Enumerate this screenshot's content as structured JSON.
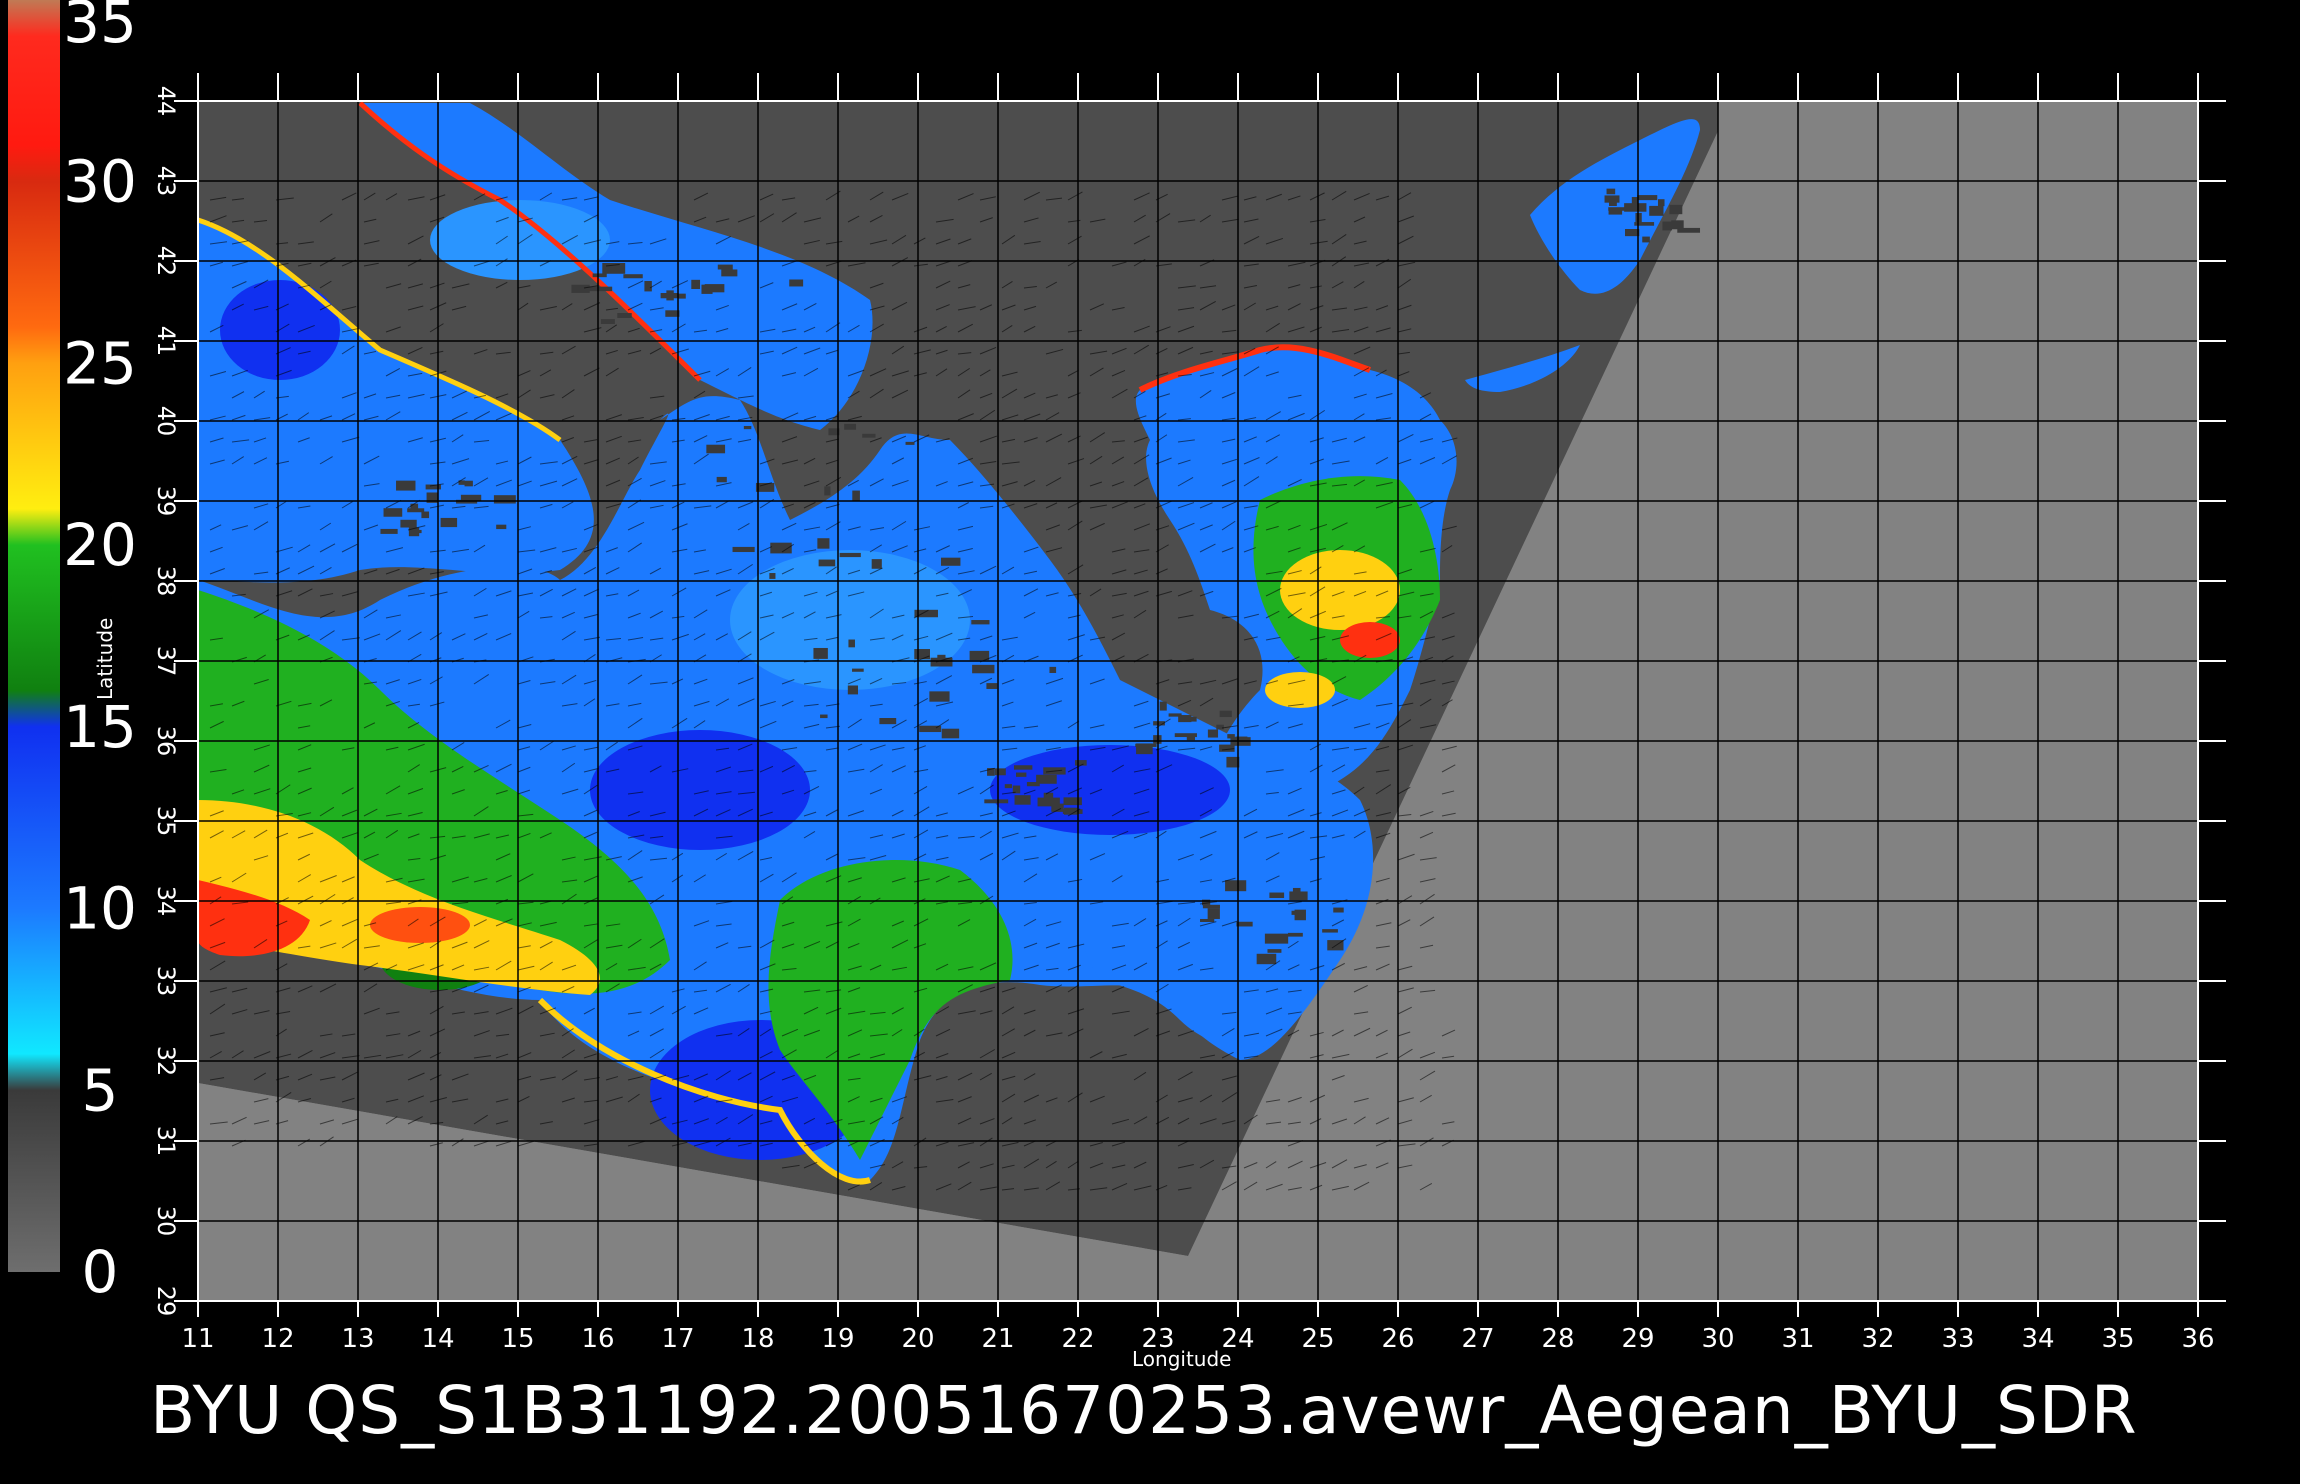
{
  "colorbar": {
    "ticks": [
      "35",
      "30",
      "25",
      "20",
      "15",
      "10",
      "5",
      "0"
    ],
    "stops": [
      {
        "v": 35,
        "color": "#c07a55"
      },
      {
        "v": 34,
        "color": "#ff2a1e"
      },
      {
        "v": 31,
        "color": "#ff1a10"
      },
      {
        "v": 30,
        "color": "#d82a10"
      },
      {
        "v": 26,
        "color": "#ff6a10"
      },
      {
        "v": 25,
        "color": "#ffa010"
      },
      {
        "v": 21,
        "color": "#ffee10"
      },
      {
        "v": 20,
        "color": "#20c020"
      },
      {
        "v": 16,
        "color": "#108010"
      },
      {
        "v": 15,
        "color": "#1030f0"
      },
      {
        "v": 10,
        "color": "#1c7aff"
      },
      {
        "v": 6,
        "color": "#10e8ff"
      },
      {
        "v": 5,
        "color": "#3a3a3a"
      },
      {
        "v": 0,
        "color": "#6e6e6e"
      }
    ]
  },
  "map": {
    "x_axis": {
      "label": "Longitude",
      "ticks": [
        "11",
        "12",
        "13",
        "14",
        "15",
        "16",
        "17",
        "18",
        "19",
        "20",
        "21",
        "22",
        "23",
        "24",
        "25",
        "26",
        "27",
        "28",
        "29",
        "30",
        "31",
        "32",
        "33",
        "34",
        "35",
        "36"
      ]
    },
    "y_axis": {
      "label": "Latitude",
      "ticks": [
        "29",
        "30",
        "31",
        "32",
        "33",
        "34",
        "35",
        "36",
        "37",
        "38",
        "39",
        "40",
        "41",
        "42",
        "43",
        "44"
      ]
    },
    "colors": {
      "land": "#4d4d4d",
      "no_data": "#828282",
      "grid": "#000000",
      "frame": "#ffffff"
    }
  },
  "caption": "BYU  QS_S1B31192.20051670253.avewr_Aegean_BYU_SDR"
}
